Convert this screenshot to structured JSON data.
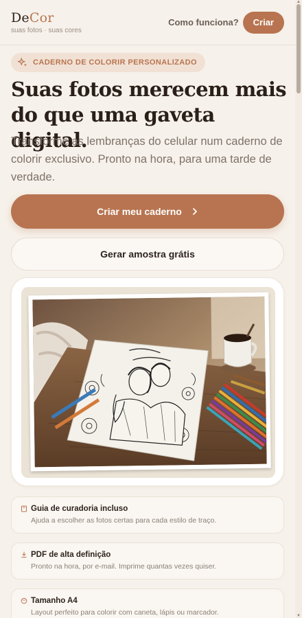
{
  "brand": {
    "name_part1": "De",
    "name_part2": "Cor",
    "tagline": "suas fotos · suas cores"
  },
  "nav": {
    "how_it_works": "Como funciona?",
    "create": "Criar"
  },
  "hero": {
    "badge": "CADERNO DE COLORIR PERSONALIZADO",
    "title": "Suas fotos merecem mais do que uma gaveta digital.",
    "subtitle": "Transforme as lembranças do celular num caderno de colorir exclusivo. Pronto na hora, para uma tarde de verdade."
  },
  "actions": {
    "primary": "Criar meu caderno",
    "primary_icon": "chevron-right-icon",
    "secondary": "Gerar amostra grátis"
  },
  "features": [
    {
      "icon": "book-icon",
      "title": "Guia de curadoria incluso",
      "desc": "Ajuda a escolher as fotos certas para cada estilo de traço."
    },
    {
      "icon": "download-icon",
      "title": "PDF de alta definição",
      "desc": "Pronto na hora, por e-mail. Imprime quantas vezes quiser."
    },
    {
      "icon": "palette-icon",
      "title": "Tamanho A4",
      "desc": "Layout perfeito para colorir com caneta, lápis ou marcador."
    }
  ],
  "colors": {
    "accent": "#b87450",
    "background": "#f6f1ea",
    "badge_bg": "#f1e1d4",
    "text": "#2e231d"
  }
}
